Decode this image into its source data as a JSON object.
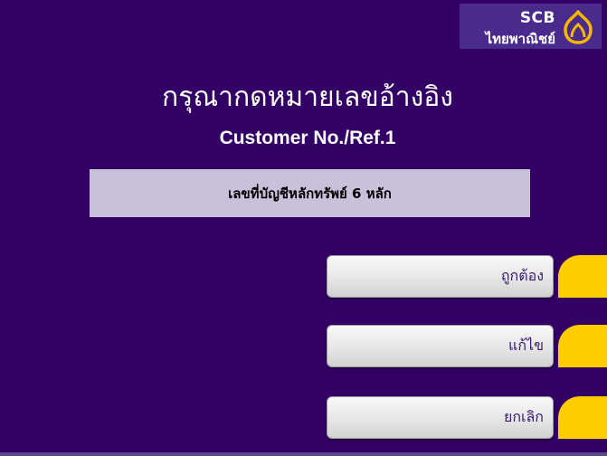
{
  "logo": {
    "name_en": "SCB",
    "name_thai": "ไทยพาณิชย์",
    "icon": "scb-lotus-icon"
  },
  "screen": {
    "title_thai": "กรุณากดหมายเลขอ้างอิง",
    "title_en": "Customer No./Ref.1",
    "hint": "เลขที่บัญชีหลักทรัพย์ 6 หลัก"
  },
  "buttons": {
    "confirm_label": "ถูกต้อง",
    "edit_label": "แก้ไข",
    "cancel_label": "ยกเลิก"
  },
  "colors": {
    "background": "#330066",
    "hint_box": "#c9c1dc",
    "side_key": "#ffcc00",
    "logo_panel": "#4a2a8c"
  }
}
